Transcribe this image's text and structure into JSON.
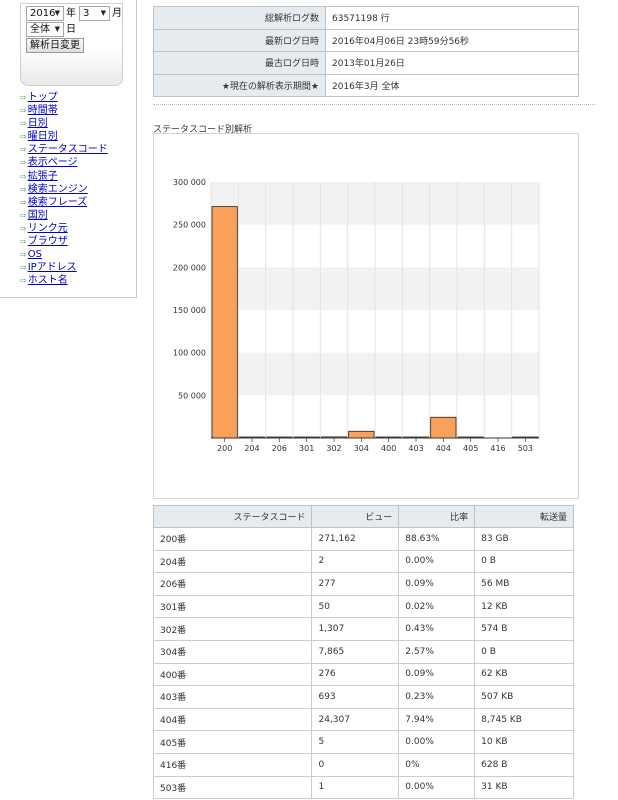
{
  "date_selector": {
    "year": "2016",
    "year_unit": "年",
    "month": "3",
    "month_unit": "月",
    "day": "全体",
    "day_unit": "日",
    "change_button": "解析日変更"
  },
  "nav": [
    {
      "label": "トップ"
    },
    {
      "label": "時間帯"
    },
    {
      "label": "日別"
    },
    {
      "label": "曜日別"
    },
    {
      "label": "ステータスコード"
    },
    {
      "label": "表示ページ"
    },
    {
      "label": "拡張子"
    },
    {
      "label": "検索エンジン"
    },
    {
      "label": "検索フレーズ"
    },
    {
      "label": "国別"
    },
    {
      "label": "リンク元"
    },
    {
      "label": "ブラウザ"
    },
    {
      "label": "OS"
    },
    {
      "label": "IPアドレス"
    },
    {
      "label": "ホスト名"
    }
  ],
  "summary": [
    {
      "key": "総解析ログ数",
      "value": "63571198 行"
    },
    {
      "key": "最新ログ日時",
      "value": "2016年04月06日 23時59分56秒"
    },
    {
      "key": "最古ログ日時",
      "value": "2013年01月26日"
    },
    {
      "key": "★現在の解析表示期間★",
      "value": "2016年3月 全体"
    }
  ],
  "section_title": "ステータスコード別解析",
  "chart_data": {
    "type": "bar",
    "categories": [
      "200",
      "204",
      "206",
      "301",
      "302",
      "304",
      "400",
      "403",
      "404",
      "405",
      "416",
      "503"
    ],
    "values": [
      271162,
      2,
      277,
      50,
      1307,
      7865,
      276,
      693,
      24307,
      5,
      0,
      1
    ],
    "yticks": [
      "50 000",
      "100 000",
      "150 000",
      "200 000",
      "250 000",
      "300 000"
    ],
    "ylim": [
      0,
      300000
    ],
    "grid": true,
    "bar_color": "#f9a15b",
    "band_color": "#f2f2f2"
  },
  "table": {
    "headers": [
      "ステータスコード",
      "ビュー",
      "比率",
      "転送量"
    ],
    "rows": [
      {
        "code": "200番",
        "views": "271,162",
        "ratio": "88.63%",
        "transfer": "83 GB"
      },
      {
        "code": "204番",
        "views": "2",
        "ratio": "0.00%",
        "transfer": "0 B"
      },
      {
        "code": "206番",
        "views": "277",
        "ratio": "0.09%",
        "transfer": "56 MB"
      },
      {
        "code": "301番",
        "views": "50",
        "ratio": "0.02%",
        "transfer": "12 KB"
      },
      {
        "code": "302番",
        "views": "1,307",
        "ratio": "0.43%",
        "transfer": "574 B"
      },
      {
        "code": "304番",
        "views": "7,865",
        "ratio": "2.57%",
        "transfer": "0 B"
      },
      {
        "code": "400番",
        "views": "276",
        "ratio": "0.09%",
        "transfer": "62 KB"
      },
      {
        "code": "403番",
        "views": "693",
        "ratio": "0.23%",
        "transfer": "507 KB"
      },
      {
        "code": "404番",
        "views": "24,307",
        "ratio": "7.94%",
        "transfer": "8,745 KB"
      },
      {
        "code": "405番",
        "views": "5",
        "ratio": "0.00%",
        "transfer": "10 KB"
      },
      {
        "code": "416番",
        "views": "0",
        "ratio": "0%",
        "transfer": "628 B"
      },
      {
        "code": "503番",
        "views": "1",
        "ratio": "0.00%",
        "transfer": "31 KB"
      }
    ]
  }
}
